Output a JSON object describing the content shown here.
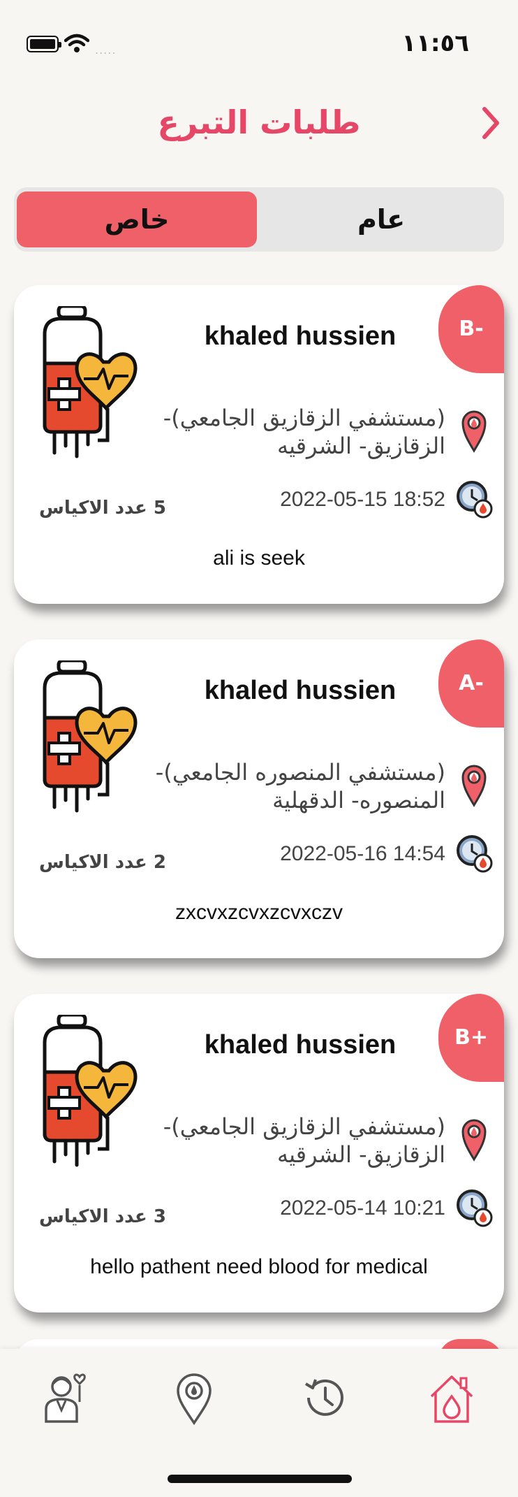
{
  "status_bar": {
    "time": "١١:٥٦",
    "signal": "....."
  },
  "header": {
    "title": "طلبات التبرع",
    "back_icon": "chevron-right-icon"
  },
  "tabs": {
    "private_label": "خاص",
    "public_label": "عام",
    "selected": "خاص"
  },
  "colors": {
    "accent": "#f06069",
    "title": "#e64766",
    "background": "#f7f6f3"
  },
  "requests": [
    {
      "blood_type": "B-",
      "name": "khaled hussien",
      "hospital": "(مستشفي الزقازيق الجامعي)- الزقازيق- الشرقيه",
      "datetime": "2022-05-15 18:52",
      "bags": "5 عدد الاكياس",
      "note": "ali is seek"
    },
    {
      "blood_type": "A-",
      "name": "khaled hussien",
      "hospital": "(مستشفي المنصوره الجامعي)- المنصوره- الدقهلية",
      "datetime": "2022-05-16 14:54",
      "bags": "2 عدد الاكياس",
      "note": "zxcvxzcvxzcvxczv"
    },
    {
      "blood_type": "B+",
      "name": "khaled hussien",
      "hospital": "(مستشفي الزقازيق الجامعي)- الزقازيق- الشرقيه",
      "datetime": "2022-05-14 10:21",
      "bags": "3 عدد الاكياس",
      "note": "hello pathent need blood for medical"
    }
  ],
  "bottom_nav": {
    "items": [
      "profile-icon",
      "location-icon",
      "history-icon",
      "home-icon"
    ],
    "active": "home-icon"
  }
}
